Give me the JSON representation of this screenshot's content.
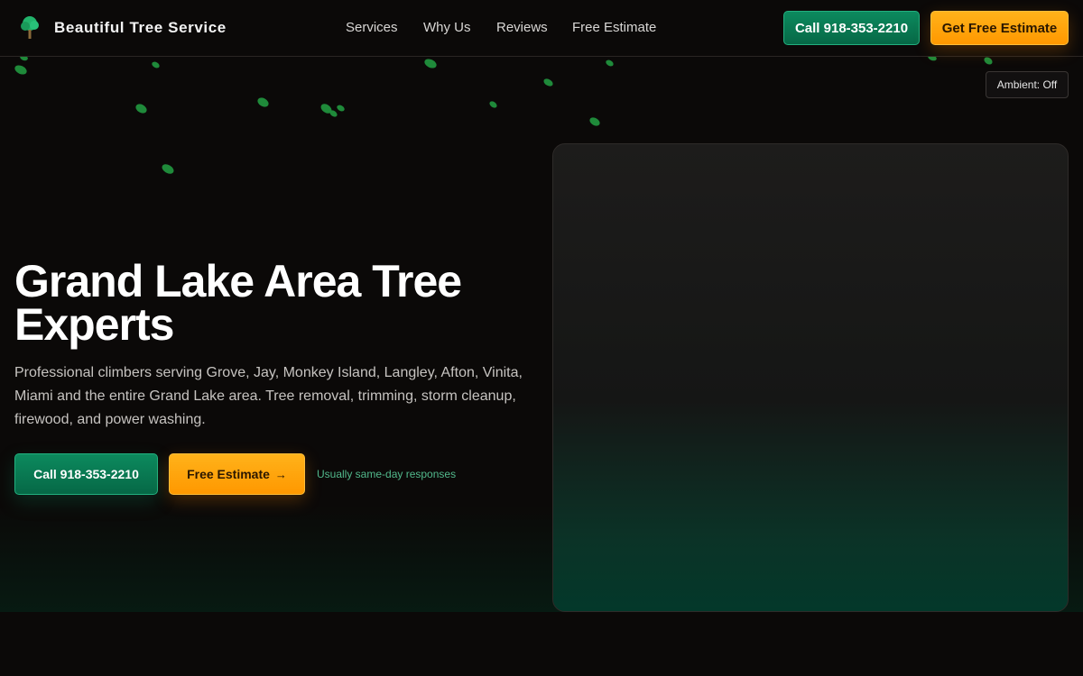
{
  "header": {
    "brand": "Beautiful Tree Service",
    "logo_icon": "tree-icon",
    "nav": [
      "Services",
      "Why Us",
      "Reviews",
      "Free Estimate"
    ],
    "call_button": "Call 918-353-2210",
    "estimate_button": "Get Free Estimate"
  },
  "ambient_toggle": "Ambient: Off",
  "hero": {
    "title": "Grand Lake Area Tree Experts",
    "subtitle": "Professional climbers serving Grove, Jay, Monkey Island, Langley, Afton, Vinita, Miami and the entire Grand Lake area. Tree removal, trimming, storm cleanup, firewood, and power washing.",
    "call_button": "Call 918-353-2210",
    "estimate_button": "Free Estimate",
    "estimate_arrow": "→",
    "response_note": "Usually same-day responses"
  },
  "colors": {
    "background": "#0b0908",
    "green_accent": "#0c8a5e",
    "orange_accent": "#ff9f0f",
    "leaf": "#1f8a3a"
  }
}
